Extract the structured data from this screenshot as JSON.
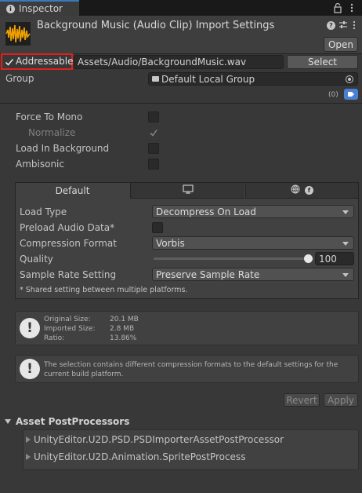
{
  "tab": {
    "title": "Inspector",
    "icon": "info-icon"
  },
  "header": {
    "title": "Background Music (Audio Clip) Import Settings",
    "open_label": "Open",
    "icons": [
      "help-icon",
      "presets-icon",
      "more-icon"
    ]
  },
  "addressable": {
    "label": "Addressable",
    "checked": true,
    "path": "Assets/Audio/BackgroundMusic.wav",
    "select_label": "Select",
    "group_label": "Group",
    "group_value": "Default Local Group",
    "labels_count": "(0)"
  },
  "props": {
    "force_to_mono": "Force To Mono",
    "normalize": "Normalize",
    "load_in_background": "Load In Background",
    "ambisonic": "Ambisonic"
  },
  "platform_tabs": {
    "default": "Default"
  },
  "settings": {
    "load_type_label": "Load Type",
    "load_type_value": "Decompress On Load",
    "preload_label": "Preload Audio Data*",
    "compression_label": "Compression Format",
    "compression_value": "Vorbis",
    "quality_label": "Quality",
    "quality_value": "100",
    "sample_rate_label": "Sample Rate Setting",
    "sample_rate_value": "Preserve Sample Rate",
    "shared_note": "* Shared setting between multiple platforms."
  },
  "info": {
    "original_label": "Original Size:",
    "original_value": "20.1 MB",
    "imported_label": "Imported Size:",
    "imported_value": "2.8 MB",
    "ratio_label": "Ratio:",
    "ratio_value": "13.86%"
  },
  "warning": {
    "text": "The selection contains different compression formats to the default settings for the current build platform."
  },
  "actions": {
    "revert": "Revert",
    "apply": "Apply"
  },
  "postprocessors": {
    "title": "Asset PostProcessors",
    "items": [
      "UnityEditor.U2D.PSD.PSDImporterAssetPostProcessor",
      "UnityEditor.U2D.Animation.SpritePostProcess"
    ]
  },
  "colors": {
    "accent_blue": "#3a79bb",
    "highlight_red": "#e0201e",
    "label_tag": "#4a7fd4"
  }
}
